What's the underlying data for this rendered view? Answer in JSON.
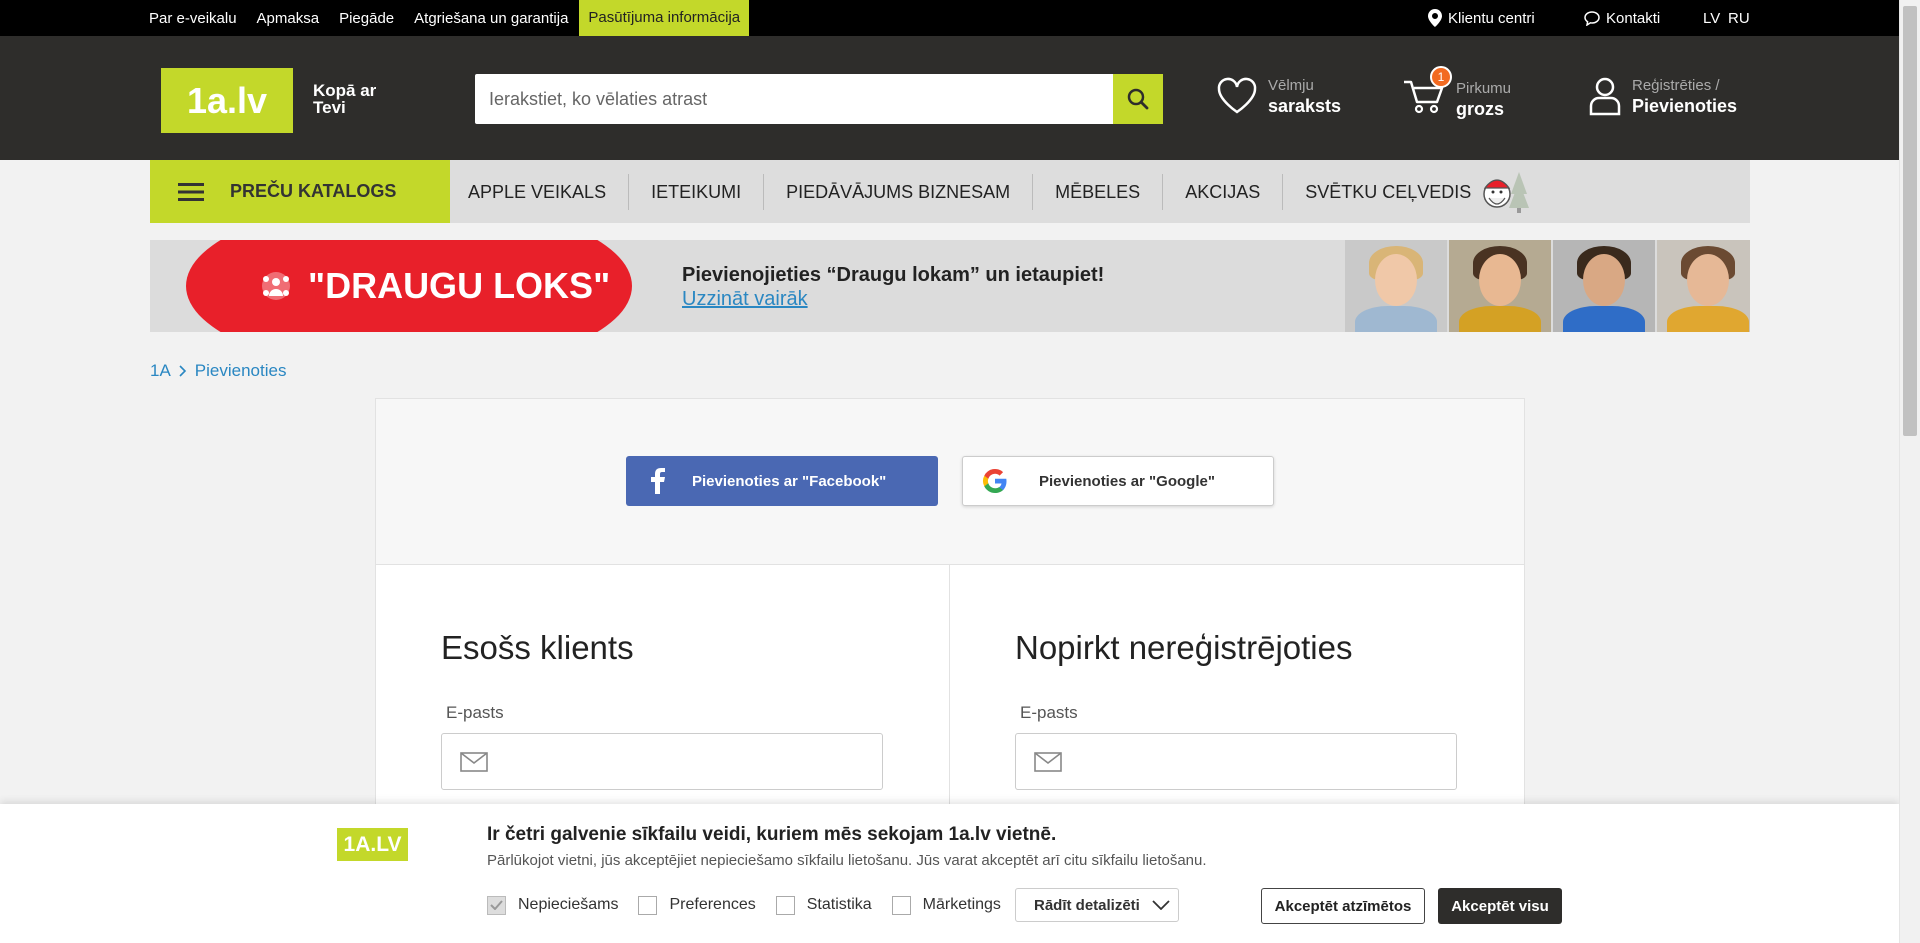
{
  "topbar": {
    "links": [
      "Par e-veikalu",
      "Apmaksa",
      "Piegāde",
      "Atgriešana un garantija",
      "Pasūtījuma informācija"
    ],
    "customer_centers": "Klientu centri",
    "contacts": "Kontakti",
    "lang_lv": "LV",
    "lang_ru": "RU"
  },
  "header": {
    "logo": "1a.lv",
    "slogan": "Kopā ar Tevi",
    "search_placeholder": "Ierakstiet, ko vēlaties atrast",
    "wishlist_small": "Vēlmju",
    "wishlist_big": "saraksts",
    "cart_small": "Pirkumu",
    "cart_big": "grozs",
    "cart_count": "1",
    "account_small": "Reģistrēties /",
    "account_big": "Pievienoties"
  },
  "nav": {
    "catalog": "PREČU KATALOGS",
    "items": [
      "APPLE VEIKALS",
      "IETEIKUMI",
      "PIEDĀVĀJUMS BIZNESAM",
      "MĒBELES",
      "AKCIJAS",
      "SVĒTKU CEĻVEDIS"
    ]
  },
  "banner": {
    "title": "\"DRAUGU LOKS\"",
    "message": "Pievienojieties “Draugu lokam” un ietaupiet!",
    "link": "Uzzināt vairāk"
  },
  "breadcrumb": {
    "home": "1A",
    "current": "Pievienoties"
  },
  "social": {
    "facebook": "Pievienoties ar \"Facebook\"",
    "google": "Pievienoties ar \"Google\""
  },
  "existing": {
    "title": "Esošs klients",
    "email_label": "E-pasts"
  },
  "guest": {
    "title": "Nopirkt nereģistrējoties",
    "email_label": "E-pasts"
  },
  "cookie": {
    "logo": "1A.LV",
    "title": "Ir četri galvenie sīkfailu veidi, kuriem mēs sekojam 1a.lv vietnē.",
    "description": "Pārlūkojot vietni, jūs akceptējiet nepieciešamo sīkfailu lietošanu. Jūs varat akceptēt arī citu sīkfailu lietošanu.",
    "options": [
      {
        "label": "Nepieciešams",
        "checked": true
      },
      {
        "label": "Preferences",
        "checked": false
      },
      {
        "label": "Statistika",
        "checked": false
      },
      {
        "label": "Mārketings",
        "checked": false
      }
    ],
    "details": "Rādīt detalizēti",
    "accept_selected": "Akceptēt atzīmētos",
    "accept_all": "Akceptēt visu"
  },
  "colors": {
    "brand": "#c3d82a",
    "header_bg": "#2e2d2b",
    "banner_red": "#e8202a",
    "facebook": "#4a68b3",
    "link": "#2a87c2",
    "cart_badge": "#f26a21"
  }
}
